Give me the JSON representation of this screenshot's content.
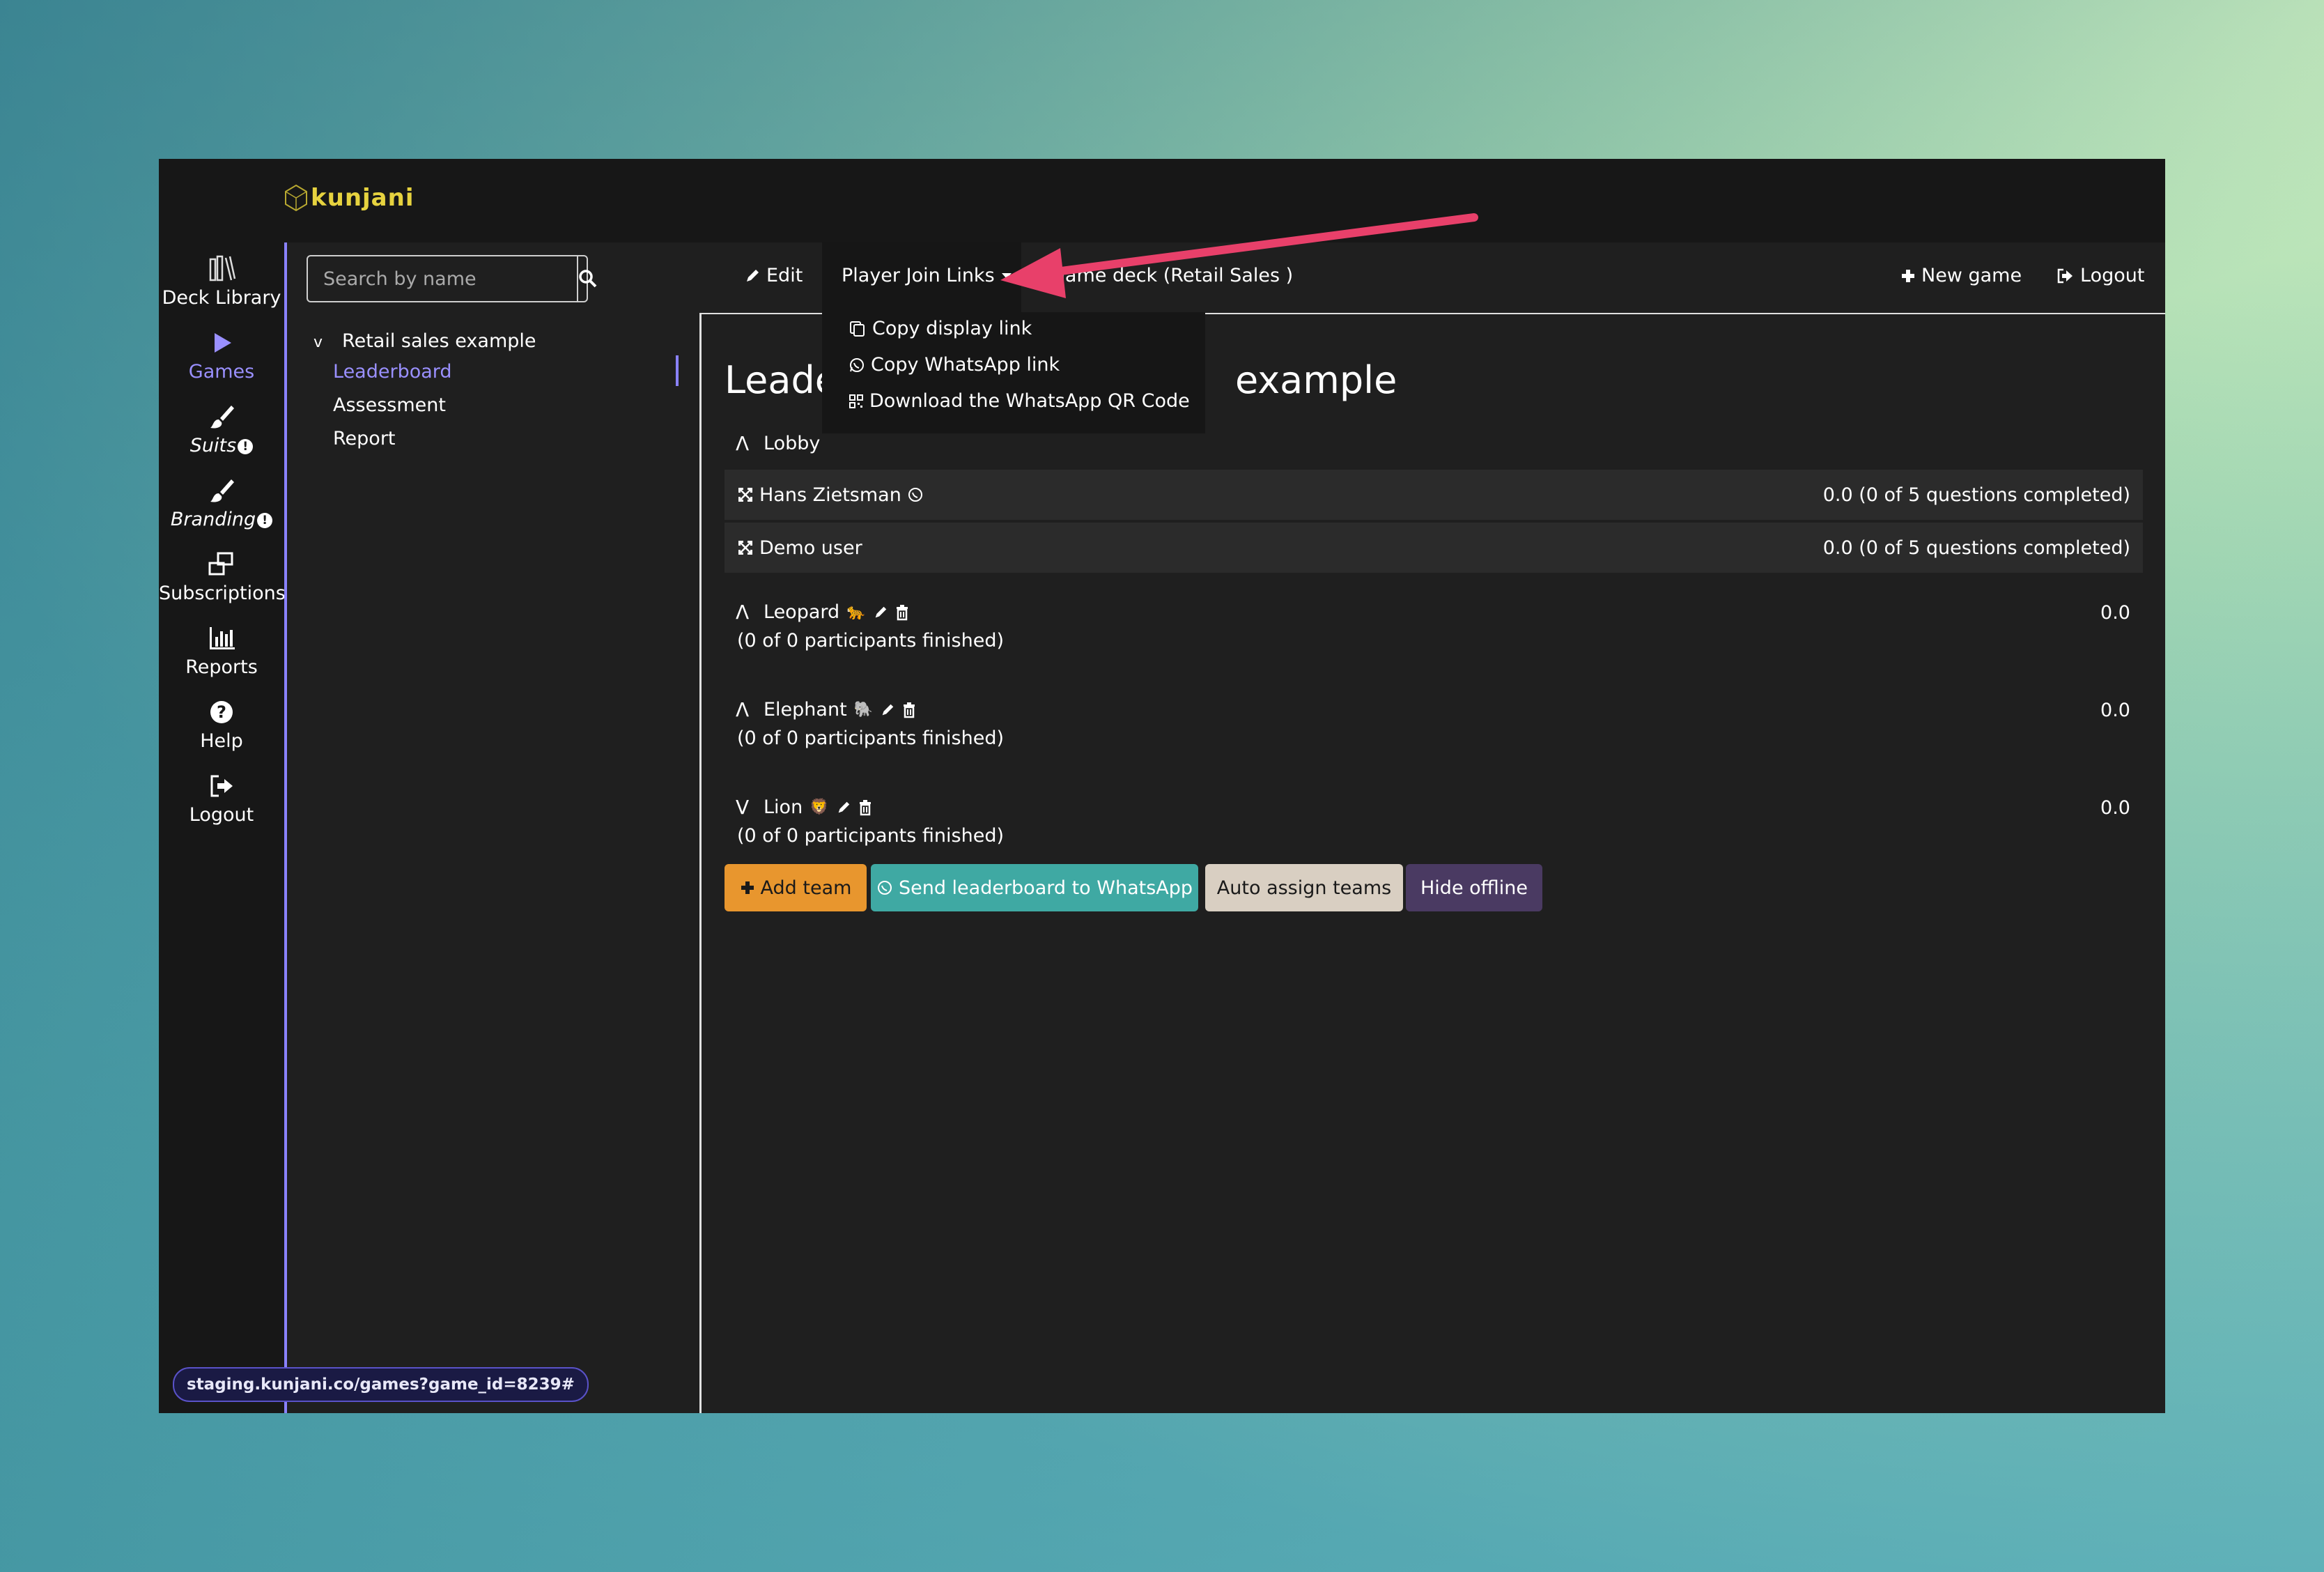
{
  "app": {
    "brand": "kunjani"
  },
  "sidebar": {
    "items": [
      {
        "label": "Deck Library",
        "icon": "books-icon"
      },
      {
        "label": "Games",
        "icon": "play-icon",
        "active": true
      },
      {
        "label": "Suits",
        "icon": "brush-icon",
        "badge": "!"
      },
      {
        "label": "Branding",
        "icon": "brush-icon",
        "badge": "!"
      },
      {
        "label": "Subscriptions",
        "icon": "windows-icon"
      },
      {
        "label": "Reports",
        "icon": "bar-chart-icon"
      },
      {
        "label": "Help",
        "icon": "question-icon"
      },
      {
        "label": "Logout",
        "icon": "sign-out-icon"
      }
    ]
  },
  "search": {
    "placeholder": "Search by name"
  },
  "tree": {
    "game": "Retail sales example",
    "children": [
      "Leaderboard",
      "Assessment",
      "Report"
    ]
  },
  "toolbar": {
    "edit": "Edit",
    "player_join_links": "Player Join Links",
    "game_deck": "Game deck (Retail Sales )",
    "new_game": "New game",
    "logout": "Logout"
  },
  "dropdown": {
    "items": [
      "Copy display link",
      "Copy WhatsApp link",
      "Download the WhatsApp QR Code"
    ]
  },
  "main": {
    "title_left": "Leade",
    "title_right": "example",
    "lobby": {
      "label": "Lobby",
      "players": [
        {
          "name": "Hans Zietsman",
          "score": "0.0 (0 of 5 questions completed)",
          "whatsapp": true
        },
        {
          "name": "Demo user",
          "score": "0.0 (0 of 5 questions completed)",
          "whatsapp": false
        }
      ]
    },
    "teams": [
      {
        "name": "Leopard",
        "emoji": "🐆",
        "score": "0.0",
        "status": "(0 of 0 participants finished)",
        "expanded": true
      },
      {
        "name": "Elephant",
        "emoji": "🐘",
        "score": "0.0",
        "status": "(0 of 0 participants finished)",
        "expanded": true
      },
      {
        "name": "Lion",
        "emoji": "🦁",
        "score": "0.0",
        "status": "(0 of 0 participants finished)",
        "expanded": false
      }
    ],
    "buttons": {
      "add_team": "Add team",
      "send_whatsapp": "Send leaderboard to WhatsApp",
      "auto_assign": "Auto assign teams",
      "hide_offline": "Hide offline"
    }
  },
  "statusbar": {
    "url": "staging.kunjani.co/games?game_id=8239#"
  },
  "colors": {
    "accent": "#8a82ff",
    "brand": "#e6d23f",
    "add_team": "#e8962e",
    "whatsapp": "#3fa9a3",
    "auto_assign": "#d9cfc2",
    "hide_offline": "#4a3a62",
    "annotation_arrow": "#e8406a"
  }
}
